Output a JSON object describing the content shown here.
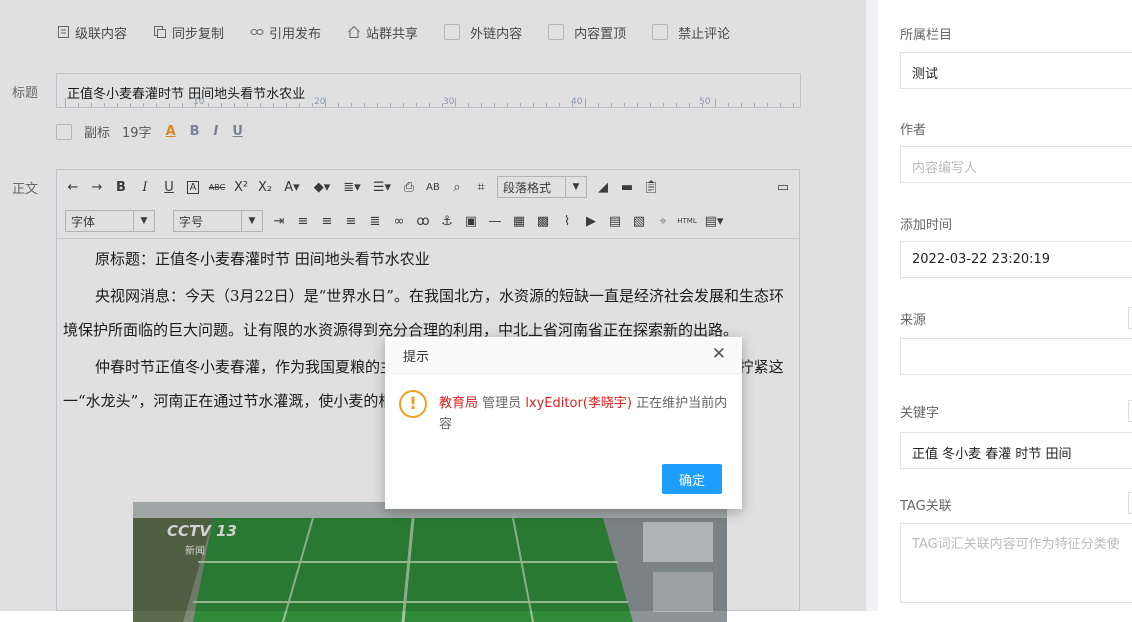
{
  "options": [
    {
      "label": "级联内容",
      "icon": "document-icon"
    },
    {
      "label": "同步复制",
      "icon": "copy-icon"
    },
    {
      "label": "引用发布",
      "icon": "link-icon"
    },
    {
      "label": "站群共享",
      "icon": "home-icon"
    }
  ],
  "option_checks": [
    {
      "label": "外链内容",
      "checked": false
    },
    {
      "label": "内容置顶",
      "checked": false
    },
    {
      "label": "禁止评论",
      "checked": false
    }
  ],
  "title": {
    "label": "标题",
    "value": "正值冬小麦春灌时节 田间地头看节水农业",
    "ruler_numbers": [
      "10",
      "20",
      "30",
      "40",
      "50"
    ]
  },
  "subtitle": {
    "label": "副标",
    "count": "19字",
    "letters": [
      "A",
      "B",
      "I",
      "U"
    ]
  },
  "body_label": "正文",
  "toolbar": {
    "paragraph_format": "段落格式",
    "font": "字体",
    "font_size": "字号",
    "html_label": "HTML"
  },
  "content": {
    "p1": "原标题：正值冬小麦春灌时节 田间地头看节水农业",
    "p2": "央视网消息：今天（3月22日）是“世界水日”。在我国北方，水资源的短缺一直是经济社会发展和生态环境保护所面临的巨大问题。让有限的水资源得到充分合理的利用，中北上省河南省正在探索新的出路。",
    "p3": "仲春时节正值冬小麦春灌，作为我国夏粮的主产区，河南小麦亩均用水为每亩每季200立方米。为拧紧这一“水龙头”，河南正在通过节水灌溉，使小麦的根系不断伸向土地深处。"
  },
  "image": {
    "logo_text": "CCTV 13",
    "logo_sub": "新闻"
  },
  "dialog": {
    "title": "提示",
    "org": "教育局",
    "role": "管理员",
    "user": "lxyEditor(李晓宇)",
    "message": "正在维护当前内容",
    "confirm": "确定"
  },
  "sidebar": {
    "category_label": "所属栏目",
    "category_value": "测试",
    "author_label": "作者",
    "author_placeholder": "内容编写人",
    "time_label": "添加时间",
    "time_value": "2022-03-22 23:20:19",
    "source_label": "来源",
    "keywords_label": "关键字",
    "keywords_value": "正值 冬小麦 春灌 时节 田间",
    "tag_label": "TAG关联",
    "tag_placeholder": "TAG词汇关联内容可作为特征分类使"
  }
}
